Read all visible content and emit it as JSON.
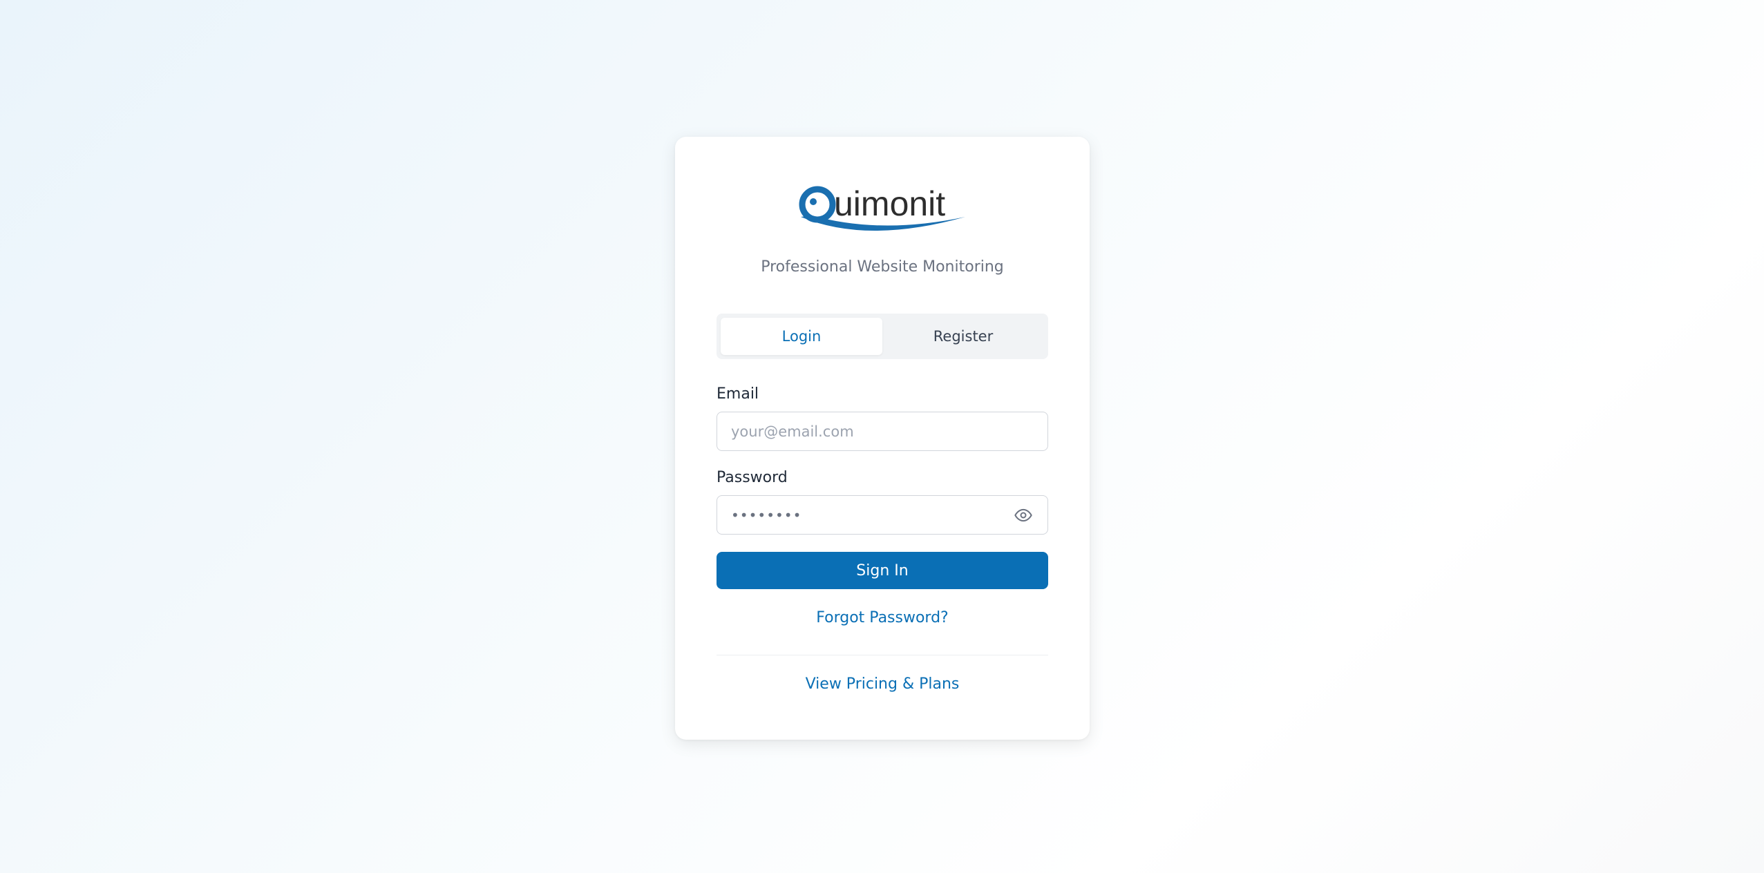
{
  "brand": {
    "logo_text": "Quimonit",
    "tagline": "Professional Website Monitoring",
    "color": "#0a6fb5"
  },
  "auth_tabs": {
    "login_label": "Login",
    "register_label": "Register",
    "active": "Login"
  },
  "form": {
    "email_label": "Email",
    "email_placeholder": "your@email.com",
    "email_value": "",
    "password_label": "Password",
    "password_masked": "••••••••",
    "password_toggle_icon": "eye-icon",
    "submit_label": "Sign In"
  },
  "links": {
    "forgot_password": "Forgot Password?",
    "pricing": "View Pricing & Plans"
  }
}
